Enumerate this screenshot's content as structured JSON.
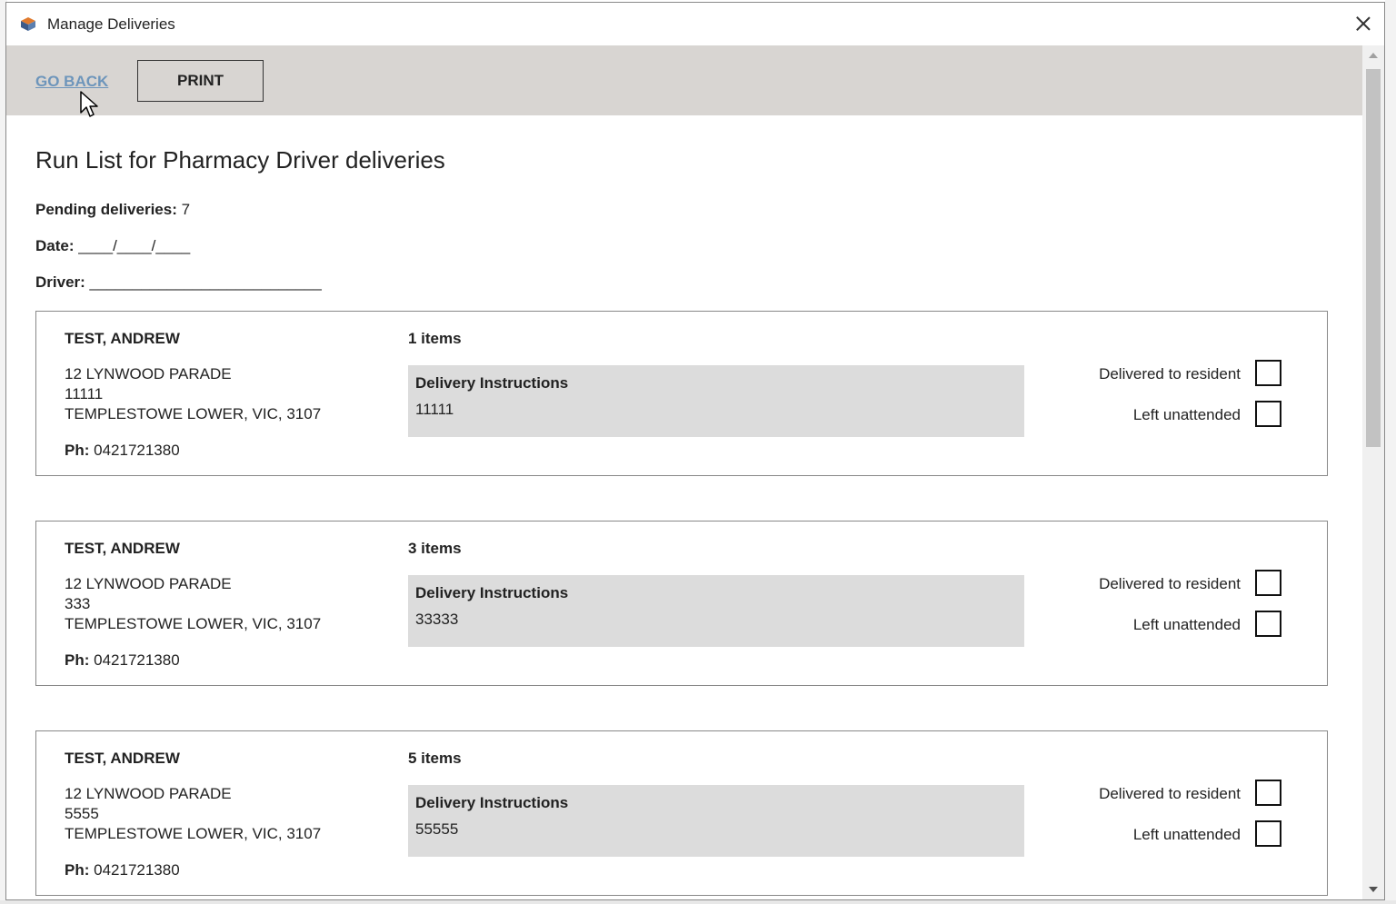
{
  "window": {
    "title": "Manage Deliveries"
  },
  "toolbar": {
    "go_back_label": "GO BACK",
    "print_label": "PRINT"
  },
  "page": {
    "title": "Run List for Pharmacy Driver deliveries",
    "pending_label": "Pending deliveries:",
    "pending_count": "7",
    "date_label": "Date:",
    "date_blank": "____/____/____",
    "driver_label": "Driver:",
    "driver_blank": "___________________________"
  },
  "deliveries": [
    {
      "name": "TEST, ANDREW",
      "address_line1": "12 LYNWOOD PARADE",
      "address_line2": "11111",
      "address_line3": "TEMPLESTOWE LOWER, VIC, 3107",
      "phone_label": "Ph:",
      "phone": "0421721380",
      "items": "1 items",
      "instructions_title": "Delivery Instructions",
      "instructions": "11111",
      "delivered_label": "Delivered to resident",
      "unattended_label": "Left unattended"
    },
    {
      "name": "TEST, ANDREW",
      "address_line1": "12 LYNWOOD PARADE",
      "address_line2": "333",
      "address_line3": "TEMPLESTOWE LOWER, VIC, 3107",
      "phone_label": "Ph:",
      "phone": "0421721380",
      "items": "3 items",
      "instructions_title": "Delivery Instructions",
      "instructions": "33333",
      "delivered_label": "Delivered to resident",
      "unattended_label": "Left unattended"
    },
    {
      "name": "TEST, ANDREW",
      "address_line1": "12 LYNWOOD PARADE",
      "address_line2": "5555",
      "address_line3": "TEMPLESTOWE LOWER, VIC, 3107",
      "phone_label": "Ph:",
      "phone": "0421721380",
      "items": "5 items",
      "instructions_title": "Delivery Instructions",
      "instructions": "55555",
      "delivered_label": "Delivered to resident",
      "unattended_label": "Left unattended"
    }
  ],
  "icons": {
    "app": "app-logo-icon",
    "close": "close-icon",
    "cursor": "mouse-cursor-icon"
  },
  "colors": {
    "toolbar_bg": "#d8d5d2",
    "link": "#6d95bb",
    "instructions_bg": "#dcdcdc"
  }
}
